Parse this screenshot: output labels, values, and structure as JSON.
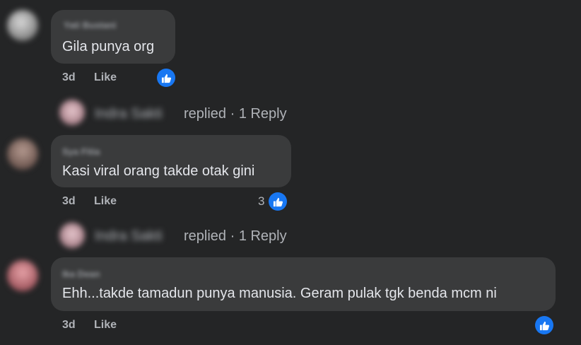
{
  "comments": [
    {
      "author": "Yati Bustani",
      "text": "Gila punya org",
      "time": "3d",
      "like_label": "Like",
      "reaction_count": ""
    },
    {
      "author": "Sya Fitia",
      "text": "Kasi viral orang takde otak gini",
      "time": "3d",
      "like_label": "Like",
      "reaction_count": "3"
    },
    {
      "author": "Ika Dean",
      "text": "Ehh...takde tamadun punya manusia. Geram pulak tgk benda mcm ni",
      "time": "3d",
      "like_label": "Like",
      "reaction_count": ""
    }
  ],
  "replies": [
    {
      "name": "Indra Sakti",
      "text": "replied · 1 Reply"
    },
    {
      "name": "Indra Sakti",
      "text": "replied · 1 Reply"
    }
  ],
  "colors": {
    "background": "#242526",
    "bubble": "#3a3b3c",
    "accent": "#1877f2"
  },
  "icons": {
    "reaction": "thumbs-up-icon"
  }
}
